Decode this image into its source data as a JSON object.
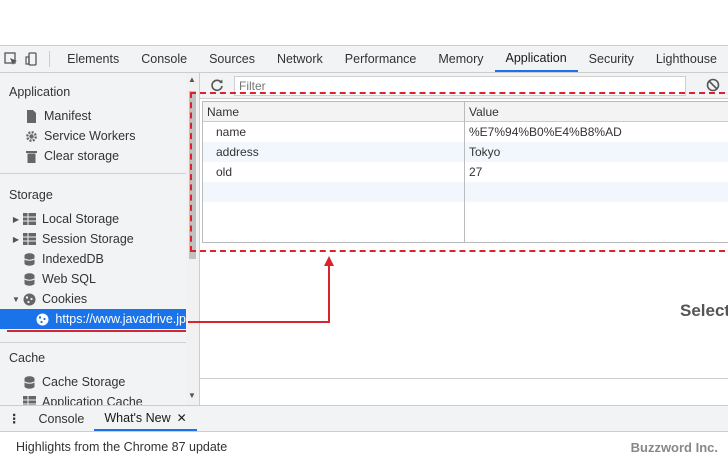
{
  "toolbar": {
    "tabs": [
      "Elements",
      "Console",
      "Sources",
      "Network",
      "Performance",
      "Memory",
      "Application",
      "Security",
      "Lighthouse"
    ],
    "active_tab": "Application"
  },
  "sidebar": {
    "sections": [
      {
        "title": "Application",
        "items": [
          "Manifest",
          "Service Workers",
          "Clear storage"
        ]
      },
      {
        "title": "Storage",
        "items": [
          "Local Storage",
          "Session Storage",
          "IndexedDB",
          "Web SQL",
          "Cookies",
          "https://www.javadrive.jp"
        ]
      },
      {
        "title": "Cache",
        "items": [
          "Cache Storage",
          "Application Cache"
        ]
      }
    ],
    "selected_item": "https://www.javadrive.jp"
  },
  "filter": {
    "placeholder": "Filter"
  },
  "table": {
    "columns": [
      "Name",
      "Value"
    ],
    "rows": [
      {
        "name": "name",
        "value": "%E7%94%B0%E4%B8%AD"
      },
      {
        "name": "address",
        "value": "Tokyo"
      },
      {
        "name": "old",
        "value": "27"
      }
    ]
  },
  "select_text": "Select",
  "drawer": {
    "tabs": [
      "Console",
      "What's New"
    ],
    "active_tab": "What's New",
    "text": "Highlights from the Chrome 87 update"
  },
  "watermark": "Buzzword Inc.",
  "colors": {
    "accent": "#1a73e8",
    "annotation": "#d9232d"
  }
}
